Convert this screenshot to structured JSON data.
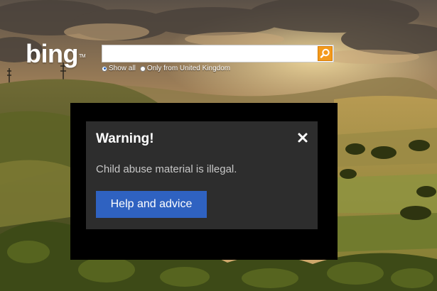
{
  "header": {
    "logo_text": "bing",
    "trademark": "TM"
  },
  "search": {
    "value": "",
    "placeholder": "",
    "button_icon": "magnifier-icon",
    "button_color": "#f39a1c"
  },
  "scope": {
    "options": [
      {
        "label": "Show all",
        "selected": true
      },
      {
        "label": "Only from United Kingdom",
        "selected": false
      }
    ]
  },
  "warning_dialog": {
    "title": "Warning!",
    "close_icon": "close-icon",
    "message": "Child abuse material is illegal.",
    "help_button_label": "Help and advice",
    "button_color": "#2f62c1"
  }
}
